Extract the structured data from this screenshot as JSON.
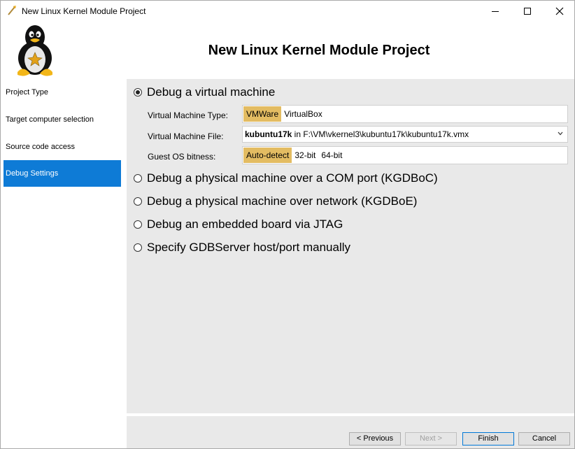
{
  "window": {
    "title": "New Linux Kernel Module Project"
  },
  "header": {
    "title": "New Linux Kernel Module Project"
  },
  "sidebar": {
    "items": [
      {
        "label": "Project Type"
      },
      {
        "label": "Target computer selection"
      },
      {
        "label": "Source code access"
      },
      {
        "label": "Debug Settings",
        "active": true
      }
    ]
  },
  "debug": {
    "options": [
      {
        "label": "Debug a virtual machine",
        "checked": true
      },
      {
        "label": "Debug a physical machine over a COM port (KGDBoC)",
        "checked": false
      },
      {
        "label": "Debug a physical machine over network (KGDBoE)",
        "checked": false
      },
      {
        "label": "Debug an embedded board via JTAG",
        "checked": false
      },
      {
        "label": "Specify GDBServer host/port manually",
        "checked": false
      }
    ],
    "vm_type": {
      "label": "Virtual Machine Type:",
      "options": [
        "VMWare",
        "VirtualBox"
      ],
      "selected": "VMWare"
    },
    "vm_file": {
      "label": "Virtual Machine File:",
      "name": "kubuntu17k",
      "path": " in F:\\VM\\vkernel3\\kubuntu17k\\kubuntu17k.vmx"
    },
    "bitness": {
      "label": "Guest OS bitness:",
      "options": [
        "Auto-detect",
        "32-bit",
        "64-bit"
      ],
      "selected": "Auto-detect"
    }
  },
  "footer": {
    "previous": "< Previous",
    "next": "Next >",
    "finish": "Finish",
    "cancel": "Cancel"
  },
  "colors": {
    "accent": "#0e7bd6",
    "selected_option": "#e3bc62",
    "panel_bg": "#e9e9e9"
  }
}
